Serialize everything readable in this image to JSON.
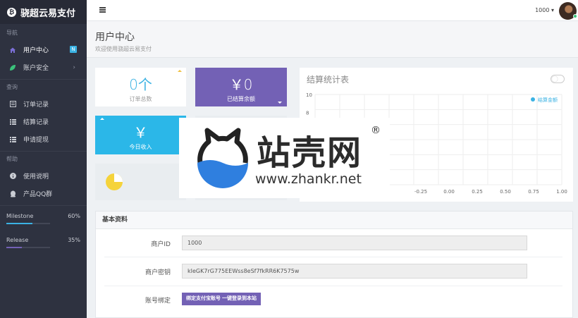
{
  "brand": {
    "name": "骁超云易支付",
    "coin": "₿"
  },
  "sidebar": {
    "sections": [
      {
        "label": "导航",
        "items": [
          {
            "label": "用户中心",
            "icon": "home-icon",
            "badge": "N",
            "active": true
          },
          {
            "label": "账户安全",
            "icon": "leaf-icon",
            "chevron": "›"
          }
        ]
      },
      {
        "label": "查询",
        "items": [
          {
            "label": "订单记录",
            "icon": "list-box-icon"
          },
          {
            "label": "结算记录",
            "icon": "list-icon"
          },
          {
            "label": "申请提现",
            "icon": "list-icon"
          }
        ]
      },
      {
        "label": "帮助",
        "items": [
          {
            "label": "使用说明",
            "icon": "info-icon"
          },
          {
            "label": "产品QQ群",
            "icon": "qq-icon"
          }
        ]
      }
    ],
    "progress": [
      {
        "label": "Milestone",
        "value": "60%",
        "fraction": 0.6
      },
      {
        "label": "Release",
        "value": "35%",
        "fraction": 0.35
      }
    ]
  },
  "topbar": {
    "user_amount": "1000 ▾"
  },
  "page": {
    "title": "用户中心",
    "subtitle": "欢迎使用骁超云易支付"
  },
  "cards": {
    "orders": {
      "value": "0个",
      "label": "订单总数"
    },
    "settled": {
      "value": "￥0",
      "label": "已结算余额"
    },
    "today": {
      "value": "￥",
      "label": "今日收入"
    }
  },
  "chart_panel": {
    "title": "结算统计表"
  },
  "chart_data": {
    "type": "line",
    "title": "结算统计表",
    "series": [
      {
        "name": "结算金额",
        "values": []
      }
    ],
    "xticks": [
      "-0.25",
      "0.00",
      "0.25",
      "0.50",
      "0.75",
      "1.00"
    ],
    "yticks": [
      "10",
      "8"
    ],
    "xlim": [
      -0.25,
      1.0
    ],
    "ylim": [
      0,
      10
    ],
    "grid": true,
    "legend": "top-right",
    "color": "#3bb2e3"
  },
  "info": {
    "title": "基本资料",
    "merchant_id_label": "商户ID",
    "merchant_id": "1000",
    "merchant_key_label": "商户密钥",
    "merchant_key": "kIeGK7rG775EEWss8eSf7fkRR6K7575w",
    "account_bind_label": "账号绑定",
    "bind_button": "绑定支付宝账号 一键登录到本站"
  },
  "watermark": {
    "cn": "站壳网",
    "reg": "®",
    "url": "www.zhankr.net"
  }
}
